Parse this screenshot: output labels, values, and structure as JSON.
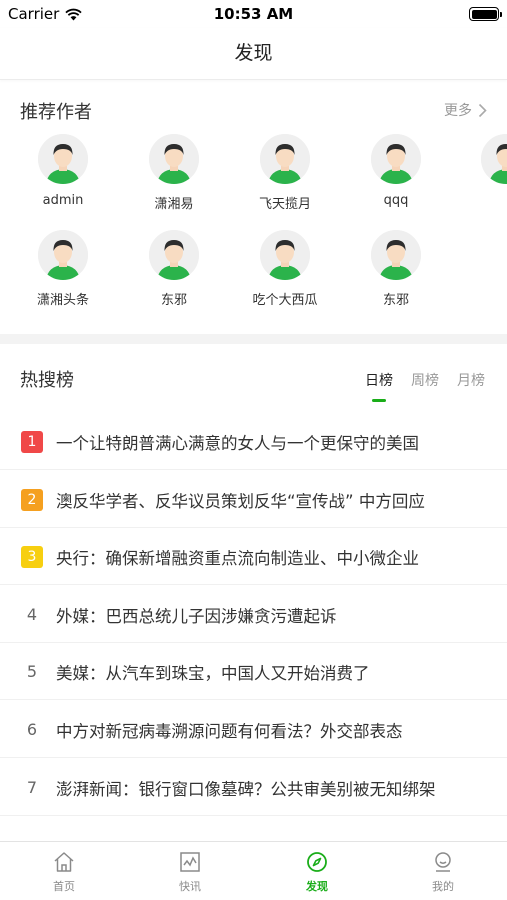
{
  "status": {
    "carrier": "Carrier",
    "time": "10:53 AM"
  },
  "nav": {
    "title": "发现"
  },
  "authors": {
    "title": "推荐作者",
    "more_label": "更多",
    "items": [
      {
        "name": "admin"
      },
      {
        "name": "潇湘易"
      },
      {
        "name": "飞天揽月"
      },
      {
        "name": "qqq"
      },
      {
        "name": "潇湘头条"
      },
      {
        "name": "东邪"
      },
      {
        "name": "吃个大西瓜"
      },
      {
        "name": "东邪"
      }
    ]
  },
  "hot": {
    "title": "热搜榜",
    "tabs": [
      {
        "label": "日榜"
      },
      {
        "label": "周榜"
      },
      {
        "label": "月榜"
      }
    ],
    "items": [
      {
        "rank": "1",
        "text": "一个让特朗普满心满意的女人与一个更保守的美国"
      },
      {
        "rank": "2",
        "text": "澳反华学者、反华议员策划反华“宣传战” 中方回应"
      },
      {
        "rank": "3",
        "text": "央行：确保新增融资重点流向制造业、中小微企业"
      },
      {
        "rank": "4",
        "text": "外媒：巴西总统儿子因涉嫌贪污遭起诉"
      },
      {
        "rank": "5",
        "text": "美媒：从汽车到珠宝，中国人又开始消费了"
      },
      {
        "rank": "6",
        "text": "中方对新冠病毒溯源问题有何看法？外交部表态"
      },
      {
        "rank": "7",
        "text": "澎湃新闻：银行窗口像墓碑？公共审美别被无知绑架"
      }
    ],
    "rank_colors": [
      "#f04848",
      "#f5a020",
      "#f7cf10"
    ]
  },
  "tabbar": {
    "items": [
      {
        "label": "首页",
        "icon": "home-icon"
      },
      {
        "label": "快讯",
        "icon": "chart-icon"
      },
      {
        "label": "发现",
        "icon": "compass-icon"
      },
      {
        "label": "我的",
        "icon": "user-icon"
      }
    ],
    "active_color": "#1aad19"
  }
}
